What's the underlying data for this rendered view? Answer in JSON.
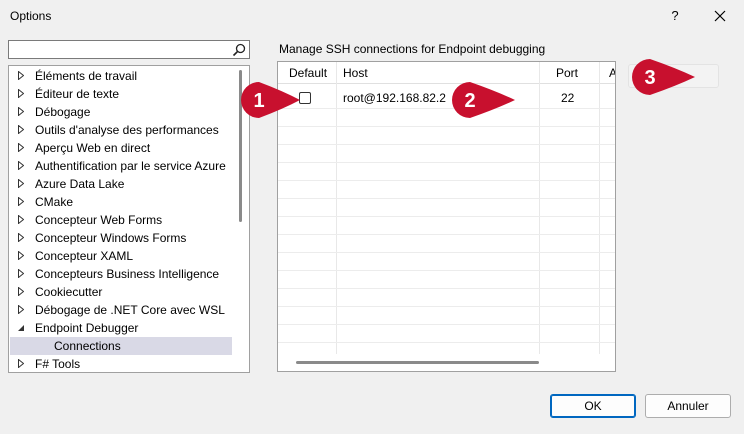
{
  "window": {
    "title": "Options",
    "help_label": "?"
  },
  "search": {
    "value": "",
    "placeholder": ""
  },
  "tree": {
    "items": [
      {
        "label": "Éléments de travail",
        "expanded": false
      },
      {
        "label": "Éditeur de texte",
        "expanded": false
      },
      {
        "label": "Débogage",
        "expanded": false
      },
      {
        "label": "Outils d'analyse des performances",
        "expanded": false
      },
      {
        "label": "Aperçu Web en direct",
        "expanded": false
      },
      {
        "label": "Authentification par le service Azure",
        "expanded": false
      },
      {
        "label": "Azure Data Lake",
        "expanded": false
      },
      {
        "label": "CMake",
        "expanded": false
      },
      {
        "label": "Concepteur Web Forms",
        "expanded": false
      },
      {
        "label": "Concepteur Windows Forms",
        "expanded": false
      },
      {
        "label": "Concepteur XAML",
        "expanded": false
      },
      {
        "label": "Concepteurs Business Intelligence",
        "expanded": false
      },
      {
        "label": "Cookiecutter",
        "expanded": false
      },
      {
        "label": "Débogage de .NET Core avec WSL",
        "expanded": false
      },
      {
        "label": "Endpoint Debugger",
        "expanded": true
      },
      {
        "label": "Connections",
        "child": true,
        "selected": true
      },
      {
        "label": "F# Tools",
        "expanded": false
      }
    ]
  },
  "panel": {
    "title": "Manage SSH connections for Endpoint debugging",
    "columns": {
      "default": "Default",
      "host": "Host",
      "port": "Port",
      "extra": "A"
    },
    "rows": [
      {
        "default": false,
        "host": "root@192.168.82.2",
        "port": "22"
      }
    ]
  },
  "callouts": {
    "one": "1",
    "two": "2",
    "three": "3"
  },
  "buttons": {
    "ok": "OK",
    "cancel": "Annuler"
  },
  "colors": {
    "callout_red": "#c8102e",
    "ok_border": "#0067c0"
  }
}
